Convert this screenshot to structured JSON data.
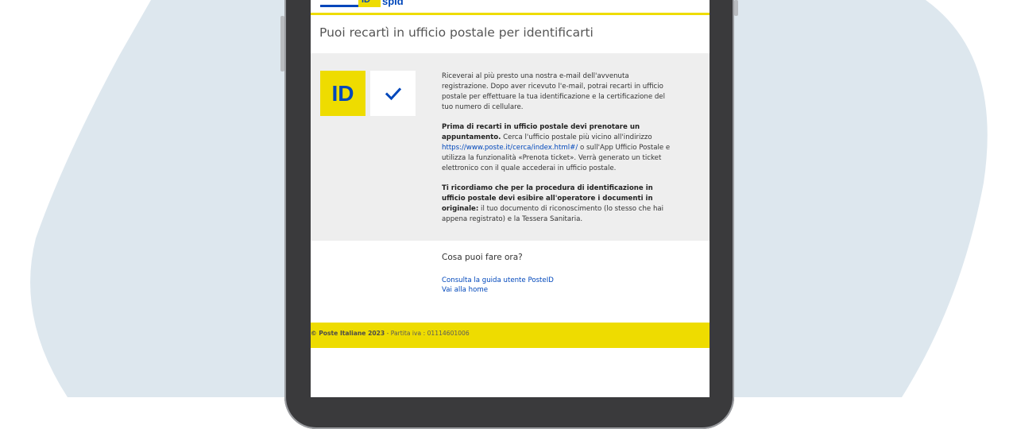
{
  "header": {
    "logo_id": "ID",
    "logo_spid": "spid"
  },
  "page": {
    "title": "Puoi recartì in ufficio postale per identificarti"
  },
  "info_panel": {
    "badge_text": "ID",
    "p1": "Riceverai al più presto una nostra e-mail dell'avvenuta registrazione. Dopo aver ricevuto l'e-mail, potrai recarti in ufficio postale per effettuare la tua identificazione e la certificazione del tuo numero di cellulare.",
    "p2_bold": "Prima di recarti in ufficio postale devi prenotare un appuntamento.",
    "p2_a": " Cerca l'ufficio postale più vicino all'indirizzo ",
    "p2_link": "https://www.poste.it/cerca/index.html#/",
    "p2_b": " o sull'App Ufficio Postale e utilizza la funzionalità «Prenota ticket». Verrà generato un ticket elettronico con il quale accederai in ufficio postale.",
    "p3_bold": "Ti ricordiamo che per la procedura di identificazione in ufficio postale devi esibire all'operatore i documenti in originale:",
    "p3_rest": " il tuo documento di riconoscimento (lo stesso che hai appena registrato) e la Tessera Sanitaria."
  },
  "next_steps": {
    "title": "Cosa puoi fare ora?",
    "link1": "Consulta la guida utente PosteID",
    "link2": "Vai alla home"
  },
  "footer": {
    "copyright": "© Poste Italiane 2023",
    "vat": " - Partita iva : 01114601006"
  },
  "colors": {
    "brand_yellow": "#eedc00",
    "brand_blue": "#0047bb",
    "panel_grey": "#eeeeee",
    "background_shape": "#dde7ee"
  }
}
